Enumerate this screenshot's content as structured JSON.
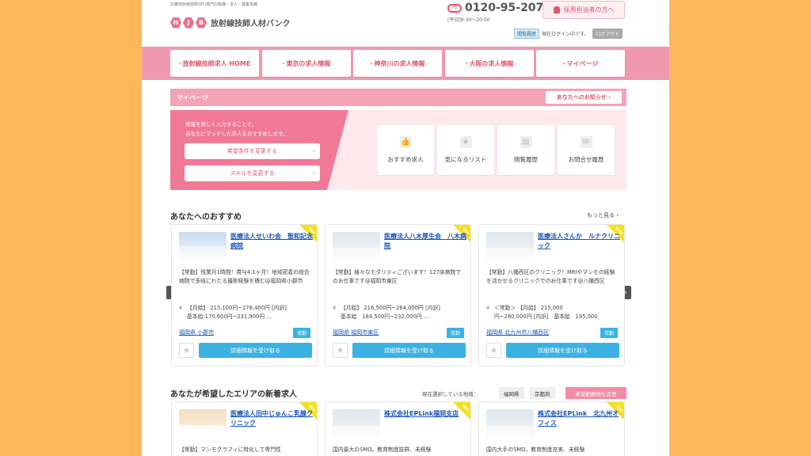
{
  "header": {
    "tagline": "診療放射線技師(RT)専門の転職・求人／募集情報",
    "logo_letters": [
      "H",
      "J",
      "B"
    ],
    "logo_text": "放射線技師人材バンク",
    "fd_label": "FD",
    "phone": "0120-95-2076",
    "hours": "[平日]9:30〜20:00",
    "recruiter_button": "採用担当者の方へ",
    "history_button": "閲覧履歴",
    "login_status": "現在ログイン中です。",
    "logout_button": "ログアウト"
  },
  "nav": [
    {
      "label": "放射線技師求人 HOME"
    },
    {
      "label": "東京の求人情報"
    },
    {
      "label": "神奈川の求人情報"
    },
    {
      "label": "大阪の求人情報"
    },
    {
      "label": "マイページ"
    }
  ],
  "mypage": {
    "title": "マイページ",
    "notice_button": "あなたへのお知らせ",
    "desc_line1": "情報を詳しく入力することで、",
    "desc_line2": "あなたにマッチした求人をおすすめします。",
    "change_conditions": "希望条件を変更する",
    "change_skills": "スキルを変更する",
    "tiles": [
      {
        "label": "おすすめ求人",
        "icon": "thumbs-up-icon",
        "glyph": "👍"
      },
      {
        "label": "気になるリスト",
        "icon": "star-icon",
        "glyph": "★"
      },
      {
        "label": "閲覧履歴",
        "icon": "document-icon",
        "glyph": "▤"
      },
      {
        "label": "お問合せ履歴",
        "icon": "mail-icon",
        "glyph": "✉"
      }
    ]
  },
  "recommend": {
    "title": "あなたへのおすすめ",
    "more": "もっと見る",
    "cards": [
      {
        "title": "医療法人せいわ会　聖和記念病院",
        "desc": "【常勤】残業月1時間！賞与4.1ヶ月！地域密着の総合病院で多岐にわたる撮影経験を積む@福岡県小郡市",
        "salary_line1": "【月給】 215,100円~276,400円 [内訳]",
        "salary_line2": "基本給:170,600円~231,900円 …",
        "pref": "福岡県",
        "city": "小郡市",
        "tag": "常勤",
        "detail": "詳細情報を受け取る",
        "badge": "NEW"
      },
      {
        "title": "医療法人八木厚生会　八木病院",
        "desc": "【常勤】様々なモダリティございます！127床病院でのお仕事です@福岡市東区",
        "salary_line1": "【月給】 216,500円~264,000円 [内訳]",
        "salary_line2": "基本給　184,500円~232,000円 …",
        "pref": "福岡県",
        "city": "福岡市東区",
        "tag": "常勤",
        "detail": "詳細情報を受け取る",
        "badge": "NEW"
      },
      {
        "title": "医療法人さんか　ルナクリニック",
        "desc": "【常勤】八幡西区のクリニック！MRIやマンモの経験を活かせるクリニックでのお仕事です@八幡西区",
        "salary_line1": "＜常勤＞ 【月給】 215,000",
        "salary_line2": "円~280,000円 [内訳]　基本給　195,000",
        "pref": "福岡県",
        "city": "北九州市八幡西区",
        "tag": "常勤",
        "detail": "詳細情報を受け取る",
        "badge": "NEW"
      }
    ]
  },
  "area": {
    "title": "あなたが希望したエリアの新着求人",
    "current_label": "現在選択している地域：",
    "chips": [
      "福岡県",
      "京都府"
    ],
    "change_button": "希望勤務地を変更",
    "cards": [
      {
        "title": "医療法人田中じゅんこ乳腺クリニック",
        "desc": "【常勤】マンモグラフィに特化して専門性",
        "badge": "NEW"
      },
      {
        "title": "株式会社EPLink福岡支店",
        "desc": "国内最大のSMO。教育制度抜群、未経験",
        "badge": "NEW"
      },
      {
        "title": "株式会社EPLink　北九州オフィス",
        "desc": "国内大手のSMO。教育制度充実、未経験",
        "badge": "NEW"
      }
    ]
  },
  "arrows": {
    "left": "‹",
    "right": "›"
  }
}
